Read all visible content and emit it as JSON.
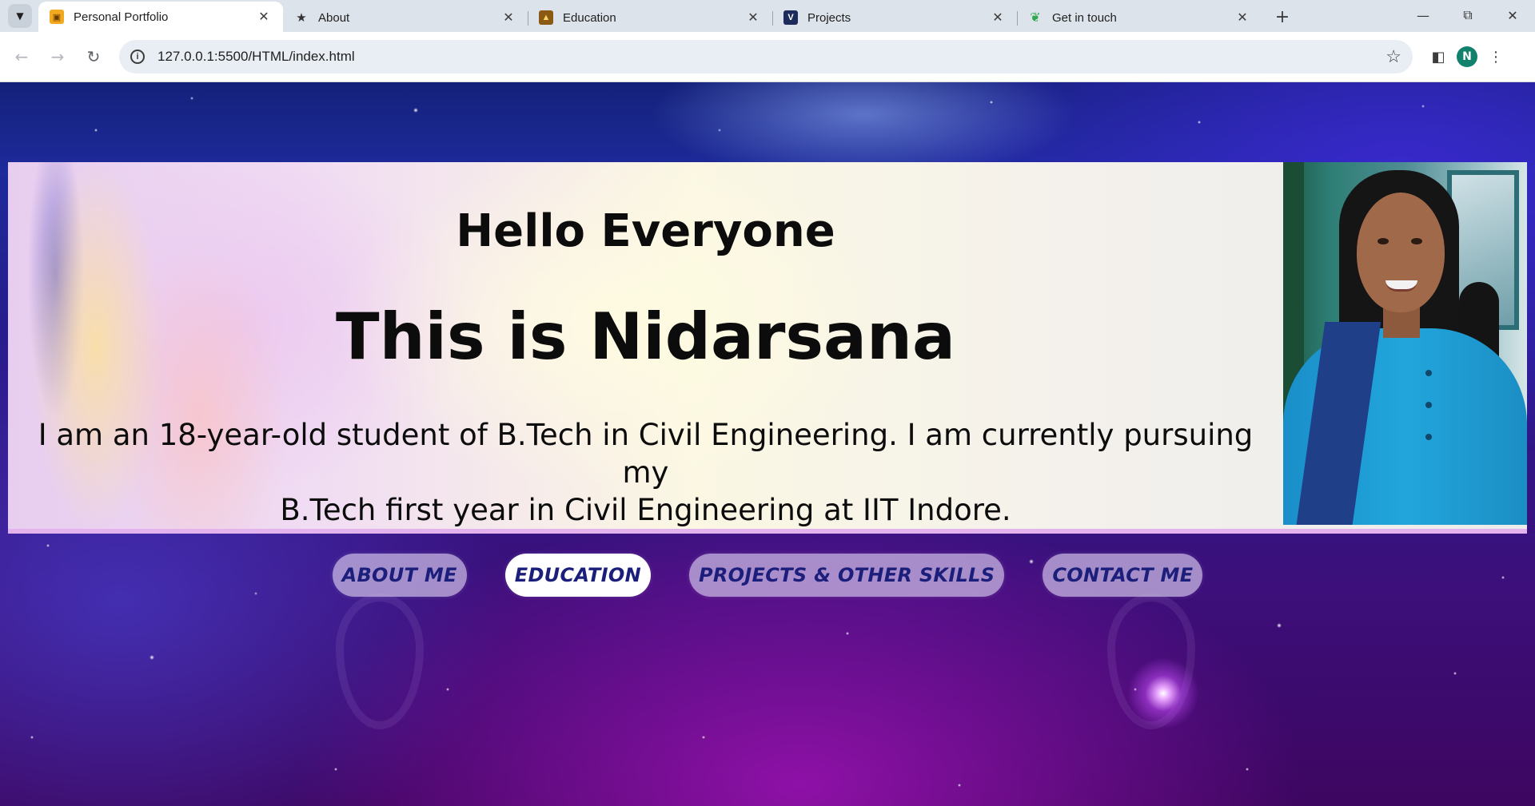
{
  "browser": {
    "tabs": [
      {
        "title": "Personal Portfolio",
        "active": true,
        "favicon": "portfolio-folder-icon",
        "favicon_color": "#f2a81f"
      },
      {
        "title": "About",
        "active": false,
        "favicon": "person-silhouette-icon",
        "favicon_color": "#333333"
      },
      {
        "title": "Education",
        "active": false,
        "favicon": "flame-icon",
        "favicon_color": "#8a5a12"
      },
      {
        "title": "Projects",
        "active": false,
        "favicon": "v-logo-icon",
        "favicon_color": "#1d2b5c"
      },
      {
        "title": "Get in touch",
        "active": false,
        "favicon": "leaf-icon",
        "favicon_color": "#2fa84f"
      }
    ],
    "url": "127.0.0.1:5500/HTML/index.html",
    "profile_initial": "N",
    "profile_color": "#12826d"
  },
  "hero": {
    "greeting": "Hello Everyone",
    "name": "This is Nidarsana",
    "bio_line1": "I am an 18-year-old student of B.Tech in Civil Engineering. I am currently pursuing my",
    "bio_line2": "B.Tech first year in Civil Engineering at IIT Indore."
  },
  "menu": {
    "items": [
      {
        "label": "ABOUT ME",
        "active": false
      },
      {
        "label": "EDUCATION",
        "active": true
      },
      {
        "label": "PROJECTS & OTHER SKILLS",
        "active": false
      },
      {
        "label": "CONTACT ME",
        "active": false
      }
    ]
  },
  "colors": {
    "menu_text": "#1b1e7a",
    "hero_border": "#e3b3ee"
  }
}
